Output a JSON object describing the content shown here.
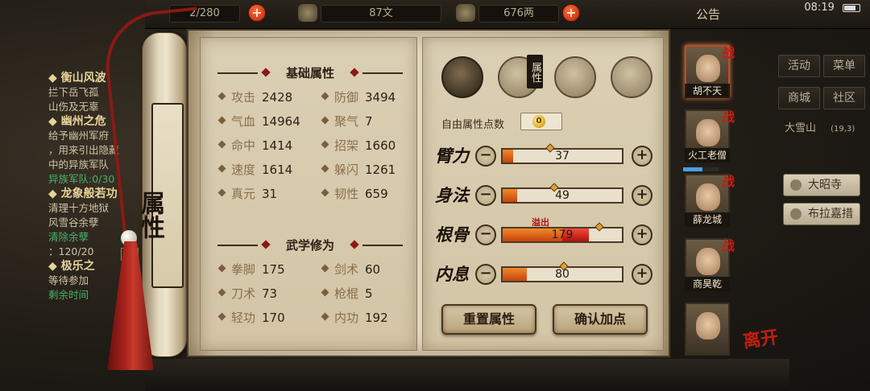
{
  "topbar": {
    "res1_text": "2/280",
    "res2_text": "87文",
    "res3_text": "676两",
    "announce": "公告",
    "clock": "08:19"
  },
  "quest": {
    "lines": [
      {
        "text": "◆ 衡山风波",
        "type": "title"
      },
      {
        "text": "拦下岳飞孤",
        "type": "body"
      },
      {
        "text": "山伤及无辜",
        "type": "body"
      },
      {
        "text": "◆ 幽州之危",
        "type": "title"
      },
      {
        "text": "给予幽州军府",
        "type": "body"
      },
      {
        "text": "，用来引出隐藏",
        "type": "body"
      },
      {
        "text": "中的异族军队",
        "type": "body"
      },
      {
        "text": "异族军队:0/30",
        "type": "warn"
      },
      {
        "text": "◆ 龙象般若功",
        "type": "title"
      },
      {
        "text": "清理十方地狱",
        "type": "body"
      },
      {
        "text": "风雪谷余孽",
        "type": "body"
      },
      {
        "text": "清除余孽",
        "type": "warn"
      },
      {
        "text": "：120/20",
        "type": "body"
      },
      {
        "text": "◆ 极乐之",
        "type": "title"
      },
      {
        "text": "等待参加",
        "type": "body"
      },
      {
        "text": "剩余时间",
        "type": "warn"
      }
    ]
  },
  "right_menu": {
    "activity": "活动",
    "menu": "菜单",
    "shop": "商城",
    "community": "社区",
    "location": "大雪山",
    "coords": "(19,3)",
    "list": [
      "大昭寺",
      "布拉嘉措"
    ]
  },
  "scroll": {
    "label": "属性"
  },
  "basic": {
    "title": "基础属性",
    "attrs": [
      {
        "label": "攻击",
        "value": "2428"
      },
      {
        "label": "防御",
        "value": "3494"
      },
      {
        "label": "气血",
        "value": "14964"
      },
      {
        "label": "聚气",
        "value": "7"
      },
      {
        "label": "命中",
        "value": "1414"
      },
      {
        "label": "招架",
        "value": "1660"
      },
      {
        "label": "速度",
        "value": "1614"
      },
      {
        "label": "躲闪",
        "value": "1261"
      },
      {
        "label": "真元",
        "value": "31"
      },
      {
        "label": "韧性",
        "value": "659"
      }
    ]
  },
  "martial": {
    "title": "武学修为",
    "attrs": [
      {
        "label": "拳脚",
        "value": "175"
      },
      {
        "label": "剑术",
        "value": "60"
      },
      {
        "label": "刀术",
        "value": "73"
      },
      {
        "label": "枪棍",
        "value": "5"
      },
      {
        "label": "轻功",
        "value": "170"
      },
      {
        "label": "内功",
        "value": "192"
      }
    ]
  },
  "tabs": {
    "badge": "属性",
    "icons": [
      "character-icon",
      "scroll-icon",
      "taiji-icon",
      "meridian-icon"
    ]
  },
  "free_points": {
    "label": "自由属性点数",
    "value": "0"
  },
  "stats": [
    {
      "name": "臂力",
      "value": "37",
      "fill": 0.09,
      "overflow": 0
    },
    {
      "name": "身法",
      "value": "49",
      "fill": 0.12,
      "overflow": 0
    },
    {
      "name": "根骨",
      "value": "179",
      "fill": 0.5,
      "overflow": 0.22
    },
    {
      "name": "内息",
      "value": "80",
      "fill": 0.2,
      "overflow": 0
    }
  ],
  "overflow_label": "溢出",
  "buttons": {
    "reset": "重置属性",
    "confirm": "确认加点"
  },
  "companions": [
    {
      "name": "胡不天",
      "battle": "战",
      "selected": true
    },
    {
      "name": "火工老僧",
      "battle": "战",
      "selected": false
    },
    {
      "name": "薛龙城",
      "battle": "战",
      "selected": false
    },
    {
      "name": "商昊乾",
      "battle": "战",
      "selected": false
    },
    {
      "name": "",
      "battle": "",
      "selected": false
    }
  ],
  "leave_label": "离开",
  "colors": {
    "accent_red": "#c01e10",
    "bar_fill": "#e0701c",
    "bar_overflow": "#d81e14",
    "parchment": "#ddd1b6"
  }
}
